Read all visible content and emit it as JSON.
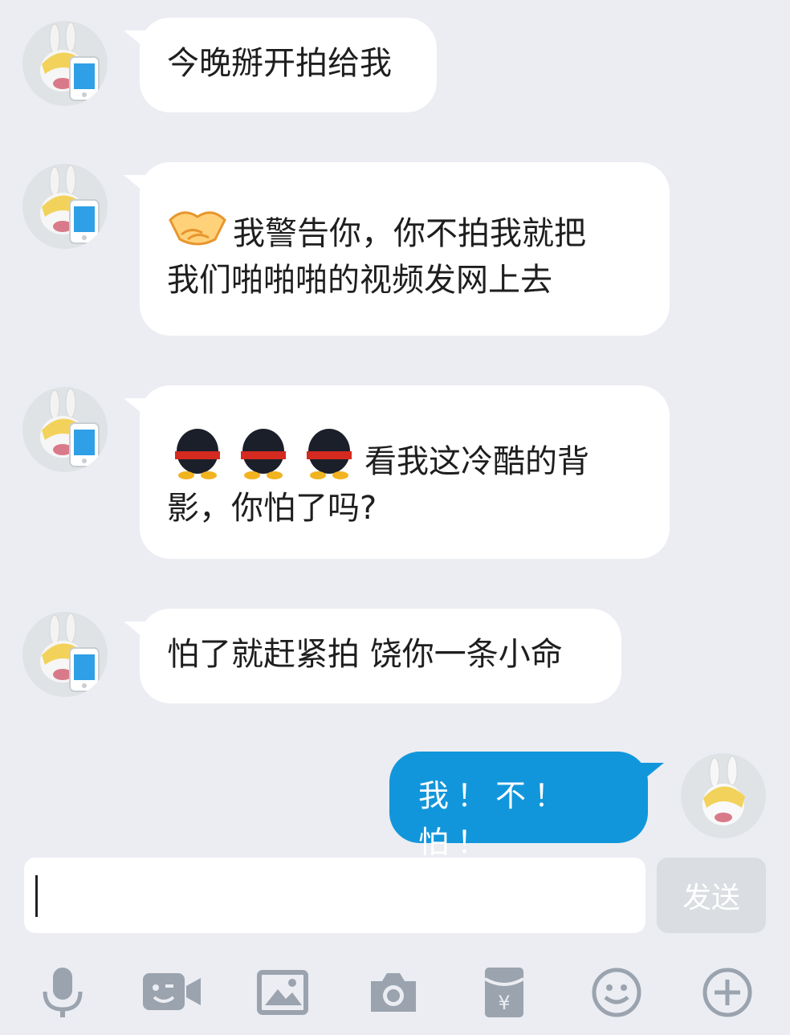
{
  "messages": [
    {
      "side": "left",
      "text": "今晚掰开拍给我"
    },
    {
      "side": "left",
      "emoji": "handshake-emoji",
      "line1": "我警告你，你不拍我就把",
      "line2": "我们啪啪啪的视频发网上去"
    },
    {
      "side": "left",
      "emoji": "penguin-back-emoji",
      "line1": "看我这冷酷的背",
      "line2": "影，你怕了吗?"
    },
    {
      "side": "left",
      "text": "怕了就赶紧拍 饶你一条小命"
    },
    {
      "side": "right",
      "text": "我！不！怕！"
    }
  ],
  "input": {
    "value": "",
    "send_label": "发送"
  },
  "toolbar": [
    "microphone-icon",
    "video-chat-icon",
    "image-icon",
    "camera-icon",
    "red-packet-icon",
    "emoji-face-icon",
    "plus-icon"
  ],
  "colors": {
    "background": "#ebedf2",
    "sent_bubble": "#1296db",
    "received_bubble": "#ffffff",
    "icon_gray": "#9aa3ae"
  }
}
